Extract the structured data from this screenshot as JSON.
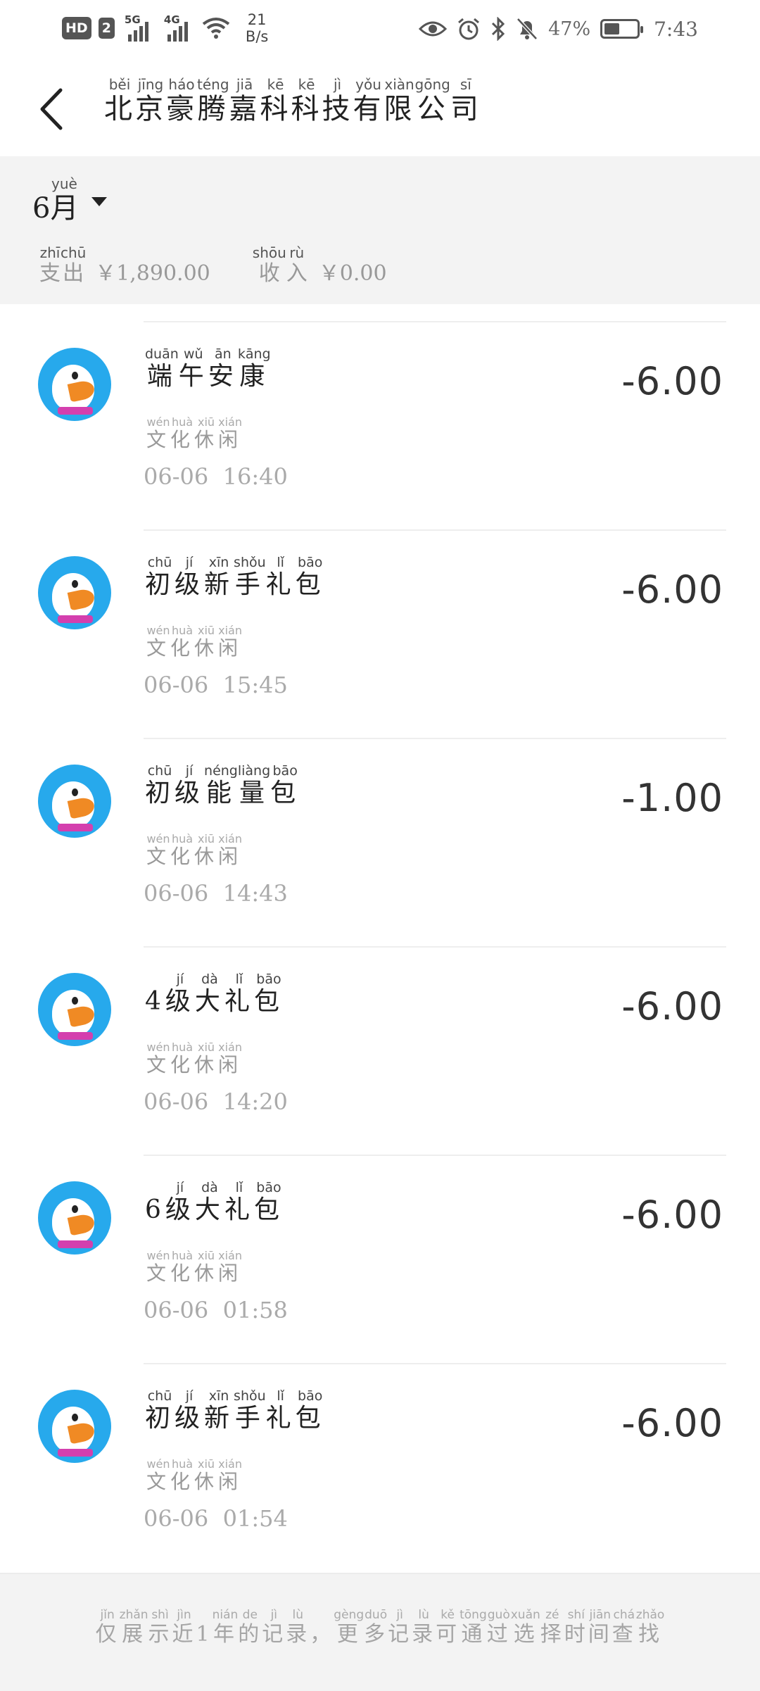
{
  "status_bar": {
    "hd_label": "HD",
    "sim_label": "2",
    "net1": "5G",
    "net2": "4G",
    "speed_value": "21",
    "speed_unit": "B/s",
    "battery_percent": "47%",
    "battery_level": 0.47,
    "time": "7:43"
  },
  "header": {
    "title": [
      {
        "char": "北",
        "py": "běi"
      },
      {
        "char": "京",
        "py": "jīng"
      },
      {
        "char": "豪",
        "py": "háo"
      },
      {
        "char": "腾",
        "py": "téng"
      },
      {
        "char": "嘉",
        "py": "jiā"
      },
      {
        "char": "科",
        "py": "kē"
      },
      {
        "char": "科",
        "py": "kē"
      },
      {
        "char": "技",
        "py": "jì"
      },
      {
        "char": "有",
        "py": "yǒu"
      },
      {
        "char": "限",
        "py": "xiàn"
      },
      {
        "char": "公",
        "py": "gōng"
      },
      {
        "char": "司",
        "py": "sī"
      }
    ]
  },
  "summary": {
    "month_num": "6",
    "month_char": "月",
    "month_py": "yuè",
    "expense_label": [
      {
        "char": "支",
        "py": "zhī"
      },
      {
        "char": "出",
        "py": "chū"
      }
    ],
    "expense_amount": "￥1,890.00",
    "income_label": [
      {
        "char": "收",
        "py": "shōu"
      },
      {
        "char": "入",
        "py": "rù"
      }
    ],
    "income_amount": "￥0.00"
  },
  "transactions": [
    {
      "name_prefix": "",
      "name": [
        {
          "char": "端",
          "py": "duān"
        },
        {
          "char": "午",
          "py": "wǔ"
        },
        {
          "char": "安",
          "py": "ān"
        },
        {
          "char": "康",
          "py": "kāng"
        }
      ],
      "category": [
        {
          "char": "文",
          "py": "wén"
        },
        {
          "char": "化",
          "py": "huà"
        },
        {
          "char": "休",
          "py": "xiū"
        },
        {
          "char": "闲",
          "py": "xián"
        }
      ],
      "time": "06-06  16:40",
      "amount": "-6.00"
    },
    {
      "name_prefix": "",
      "name": [
        {
          "char": "初",
          "py": "chū"
        },
        {
          "char": "级",
          "py": "jí"
        },
        {
          "char": "新",
          "py": "xīn"
        },
        {
          "char": "手",
          "py": "shǒu"
        },
        {
          "char": "礼",
          "py": "lǐ"
        },
        {
          "char": "包",
          "py": "bāo"
        }
      ],
      "category": [
        {
          "char": "文",
          "py": "wén"
        },
        {
          "char": "化",
          "py": "huà"
        },
        {
          "char": "休",
          "py": "xiū"
        },
        {
          "char": "闲",
          "py": "xián"
        }
      ],
      "time": "06-06  15:45",
      "amount": "-6.00"
    },
    {
      "name_prefix": "",
      "name": [
        {
          "char": "初",
          "py": "chū"
        },
        {
          "char": "级",
          "py": "jí"
        },
        {
          "char": "能",
          "py": "néng"
        },
        {
          "char": "量",
          "py": "liàng"
        },
        {
          "char": "包",
          "py": "bāo"
        }
      ],
      "category": [
        {
          "char": "文",
          "py": "wén"
        },
        {
          "char": "化",
          "py": "huà"
        },
        {
          "char": "休",
          "py": "xiū"
        },
        {
          "char": "闲",
          "py": "xián"
        }
      ],
      "time": "06-06  14:43",
      "amount": "-1.00"
    },
    {
      "name_prefix": "4",
      "name": [
        {
          "char": "级",
          "py": "jí"
        },
        {
          "char": "大",
          "py": "dà"
        },
        {
          "char": "礼",
          "py": "lǐ"
        },
        {
          "char": "包",
          "py": "bāo"
        }
      ],
      "category": [
        {
          "char": "文",
          "py": "wén"
        },
        {
          "char": "化",
          "py": "huà"
        },
        {
          "char": "休",
          "py": "xiū"
        },
        {
          "char": "闲",
          "py": "xián"
        }
      ],
      "time": "06-06  14:20",
      "amount": "-6.00"
    },
    {
      "name_prefix": "6",
      "name": [
        {
          "char": "级",
          "py": "jí"
        },
        {
          "char": "大",
          "py": "dà"
        },
        {
          "char": "礼",
          "py": "lǐ"
        },
        {
          "char": "包",
          "py": "bāo"
        }
      ],
      "category": [
        {
          "char": "文",
          "py": "wén"
        },
        {
          "char": "化",
          "py": "huà"
        },
        {
          "char": "休",
          "py": "xiū"
        },
        {
          "char": "闲",
          "py": "xián"
        }
      ],
      "time": "06-06  01:58",
      "amount": "-6.00"
    },
    {
      "name_prefix": "",
      "name": [
        {
          "char": "初",
          "py": "chū"
        },
        {
          "char": "级",
          "py": "jí"
        },
        {
          "char": "新",
          "py": "xīn"
        },
        {
          "char": "手",
          "py": "shǒu"
        },
        {
          "char": "礼",
          "py": "lǐ"
        },
        {
          "char": "包",
          "py": "bāo"
        }
      ],
      "category": [
        {
          "char": "文",
          "py": "wén"
        },
        {
          "char": "化",
          "py": "huà"
        },
        {
          "char": "休",
          "py": "xiū"
        },
        {
          "char": "闲",
          "py": "xián"
        }
      ],
      "time": "06-06  01:54",
      "amount": "-6.00"
    }
  ],
  "footer": {
    "text": [
      {
        "char": "仅",
        "py": "jǐn"
      },
      {
        "char": "展",
        "py": "zhǎn"
      },
      {
        "char": "示",
        "py": "shì"
      },
      {
        "char": "近",
        "py": "jìn"
      },
      {
        "char": "1",
        "py": ""
      },
      {
        "char": "年",
        "py": "nián"
      },
      {
        "char": "的",
        "py": "de"
      },
      {
        "char": "记",
        "py": "jì"
      },
      {
        "char": "录",
        "py": "lù"
      },
      {
        "char": "，",
        "py": ""
      },
      {
        "char": "更",
        "py": "gèng"
      },
      {
        "char": "多",
        "py": "duō"
      },
      {
        "char": "记",
        "py": "jì"
      },
      {
        "char": "录",
        "py": "lù"
      },
      {
        "char": "可",
        "py": "kě"
      },
      {
        "char": "通",
        "py": "tōng"
      },
      {
        "char": "过",
        "py": "guò"
      },
      {
        "char": "选",
        "py": "xuǎn"
      },
      {
        "char": "择",
        "py": "zé"
      },
      {
        "char": "时",
        "py": "shí"
      },
      {
        "char": "间",
        "py": "jiān"
      },
      {
        "char": "查",
        "py": "chá"
      },
      {
        "char": "找",
        "py": "zhǎo"
      }
    ]
  }
}
